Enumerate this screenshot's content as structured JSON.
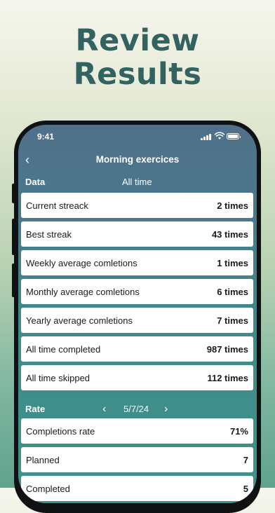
{
  "headline": {
    "line1": "Review",
    "line2": "Results"
  },
  "status_bar": {
    "time": "9:41"
  },
  "nav": {
    "back_icon": "chevron-left-icon",
    "back_glyph": "‹",
    "title": "Morning exercices"
  },
  "data_section": {
    "label": "Data",
    "period": "All time",
    "rows": [
      {
        "label": "Current streack",
        "value": "2 times"
      },
      {
        "label": "Best streak",
        "value": "43 times"
      },
      {
        "label": "Weekly average comletions",
        "value": "1 times"
      },
      {
        "label": "Monthly average comletions",
        "value": "6 times"
      },
      {
        "label": "Yearly average comletions",
        "value": "7 times"
      },
      {
        "label": "All time completed",
        "value": "987 times"
      },
      {
        "label": "All time skipped",
        "value": "112 times"
      }
    ]
  },
  "rate_section": {
    "label": "Rate",
    "prev_glyph": "‹",
    "next_glyph": "›",
    "date": "5/7/24",
    "rows": [
      {
        "label": "Completions rate",
        "value": "71%"
      },
      {
        "label": "Planned",
        "value": "7"
      },
      {
        "label": "Completed",
        "value": "5"
      }
    ]
  },
  "colors": {
    "headline": "#336361",
    "screen_top": "#51708b",
    "screen_bottom": "#3f9389",
    "row_background": "#ffffff"
  }
}
